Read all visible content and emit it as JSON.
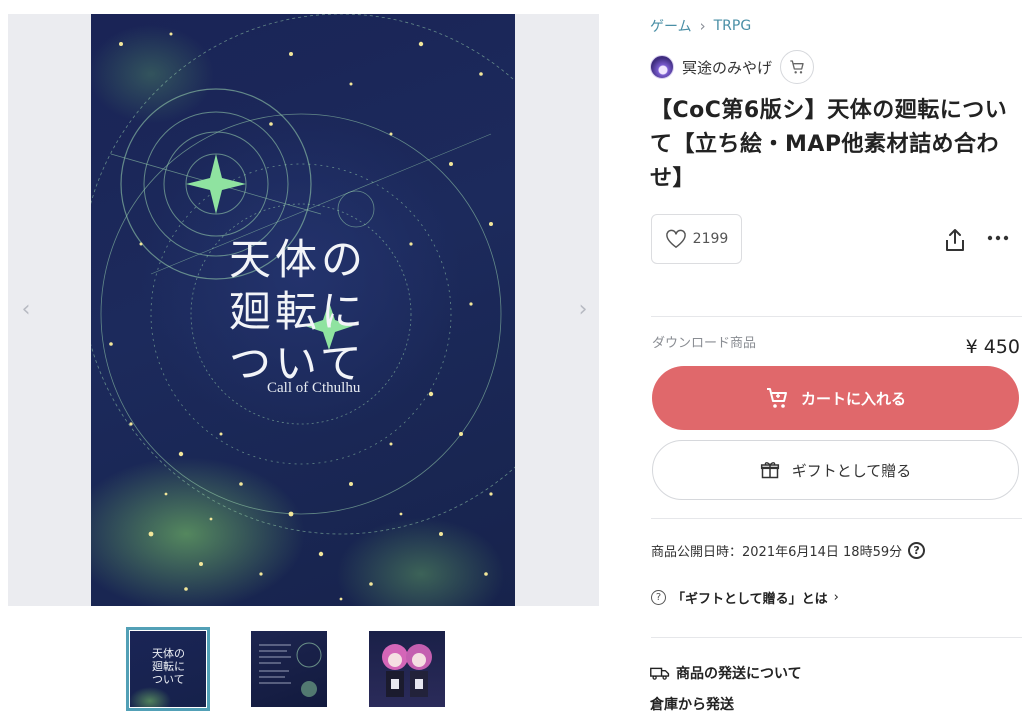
{
  "breadcrumb": {
    "category": "ゲーム",
    "subcategory": "TRPG"
  },
  "shop": {
    "name": "冥途のみやげ"
  },
  "product": {
    "title": "【CoC第6版シ】天体の廻転について【立ち絵・MAP他素材詰め合わせ】",
    "likes": "2199",
    "type_label": "ダウンロード商品",
    "price": "¥ 450"
  },
  "cover": {
    "title_jp_1": "天体の",
    "title_jp_2": "廻転に",
    "title_jp_3": "ついて",
    "title_en": "Call of Cthulhu"
  },
  "thumbnails": {
    "t1_text": "天体の廻転について"
  },
  "actions": {
    "add_to_cart": "カートに入れる",
    "send_as_gift": "ギフトとして贈る"
  },
  "info": {
    "publish_date": "商品公開日時：2021年6月14日 18時59分",
    "gift_about": "「ギフトとして贈る」とは",
    "shipping_heading": "商品の発送について",
    "shipping_from": "倉庫から発送"
  },
  "icons": {
    "gallery_prev": "chevron-left-icon",
    "gallery_next": "chevron-right-icon",
    "heart": "heart-icon",
    "share": "share-icon",
    "more": "more-icon",
    "cart": "cart-icon",
    "gift": "gift-icon",
    "help": "help-icon",
    "truck": "truck-icon"
  },
  "colors": {
    "accent_red": "#e0686b",
    "link_teal": "#4a8fa6",
    "thumb_selected": "#52a0b6"
  }
}
